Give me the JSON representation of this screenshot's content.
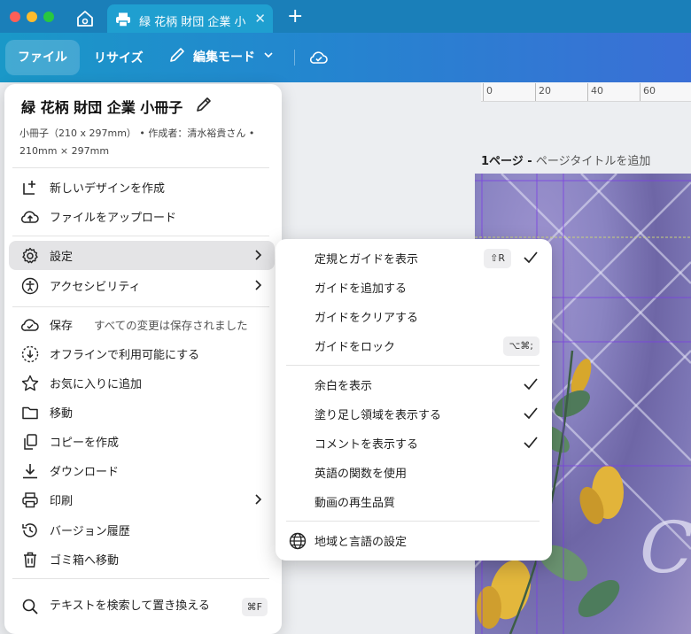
{
  "tab": {
    "title": "緑 花柄 財団 企業 小冊子"
  },
  "toolbar": {
    "file_label": "ファイル",
    "resize_label": "リサイズ",
    "edit_mode_label": "編集モード"
  },
  "ruler": {
    "labels": [
      "0",
      "20",
      "40",
      "60"
    ]
  },
  "canvas": {
    "page_label_bold": "1ページ -",
    "page_label_muted": "ページタイトルを追加"
  },
  "file_menu": {
    "title": "緑 花柄 財団 企業 小冊子",
    "meta": "小冊子（210 x 297mm） • 作成者：清水裕貴さん • 210mm × 297mm",
    "items": {
      "new_design": "新しいデザインを作成",
      "upload": "ファイルをアップロード",
      "settings": "設定",
      "accessibility": "アクセシビリティ",
      "save": "保存",
      "save_note": "すべての変更は保存されました",
      "offline": "オフラインで利用可能にする",
      "favorite": "お気に入りに追加",
      "move": "移動",
      "copy": "コピーを作成",
      "download": "ダウンロード",
      "print": "印刷",
      "history": "バージョン履歴",
      "trash": "ゴミ箱へ移動",
      "find_replace": "テキストを検索して置き換える",
      "find_replace_kbd": "⌘F"
    }
  },
  "settings_submenu": {
    "items": {
      "show_rulers": "定規とガイドを表示",
      "show_rulers_kbd": "⇧R",
      "add_guides": "ガイドを追加する",
      "clear_guides": "ガイドをクリアする",
      "lock_guides": "ガイドをロック",
      "lock_guides_kbd": "⌥⌘;",
      "show_margins": "余白を表示",
      "show_bleed": "塗り足し領域を表示する",
      "show_comments": "コメントを表示する",
      "english_functions": "英語の関数を使用",
      "video_quality": "動画の再生品質",
      "region_language": "地域と言語の設定"
    }
  },
  "colors": {
    "tabbar": "#1a7fb9",
    "toolbar_start": "#1a98c8",
    "toolbar_end": "#3b6fd6",
    "menu_active": "#e4e4e6",
    "guide_lines": "#7b3fe4"
  }
}
